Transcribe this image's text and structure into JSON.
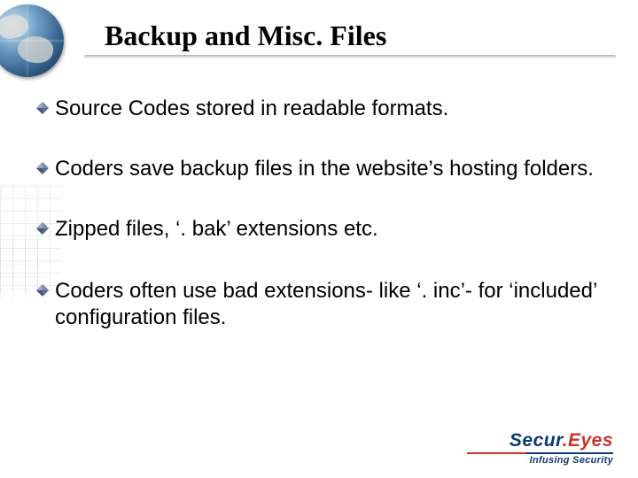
{
  "title": "Backup and Misc. Files",
  "bullets": [
    "Source Codes stored in readable formats.",
    "Coders save backup files in the website’s hosting folders.",
    "Zipped files, ‘. bak’ extensions etc.",
    "Coders often use bad extensions- like ‘. inc’- for ‘included’ configuration files."
  ],
  "brand": {
    "part1": "Secur",
    "dot": ".",
    "part2": "Eyes",
    "tagline": "Infusing Security"
  }
}
